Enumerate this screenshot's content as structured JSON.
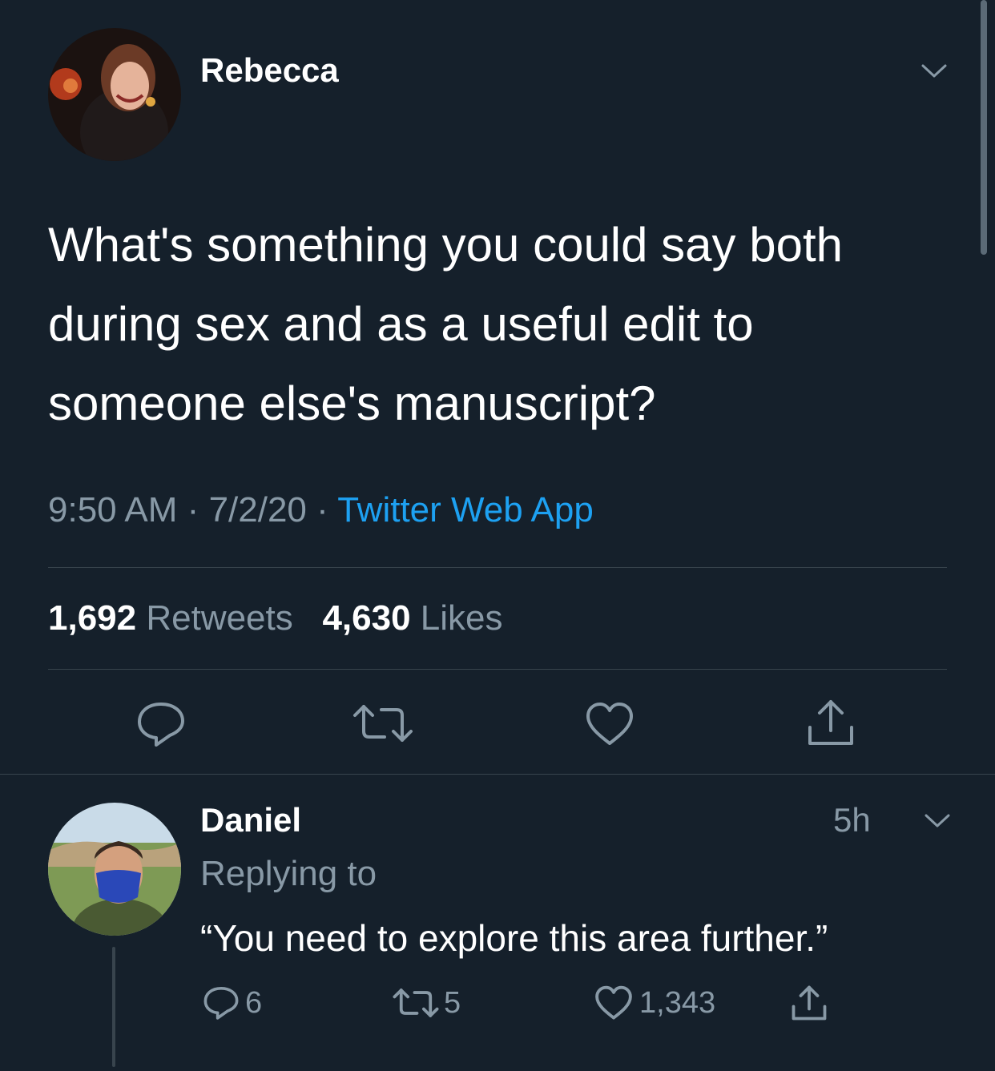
{
  "main_tweet": {
    "author_name": "Rebecca",
    "text": "What's something you could say both during sex and as a useful edit to someone else's manuscript?",
    "time": "9:50 AM",
    "date": "7/2/20",
    "sep": "·",
    "source": "Twitter Web App",
    "retweets_count": "1,692",
    "retweets_label": "Retweets",
    "likes_count": "4,630",
    "likes_label": "Likes",
    "icons": [
      "reply-icon",
      "retweet-icon",
      "like-icon",
      "share-icon",
      "chevron-down-icon"
    ]
  },
  "reply_tweet": {
    "author_name": "Daniel",
    "age": "5h",
    "replying_to": "Replying to",
    "text": "“You need to explore this area further.”",
    "reply_count": "6",
    "retweet_count": "5",
    "like_count": "1,343",
    "icons": [
      "reply-icon",
      "retweet-icon",
      "like-icon",
      "share-icon",
      "chevron-down-icon"
    ]
  },
  "colors": {
    "background": "#15202b",
    "text": "#ffffff",
    "muted": "#8899a6",
    "link": "#1da1f2",
    "divider": "#38444d"
  }
}
